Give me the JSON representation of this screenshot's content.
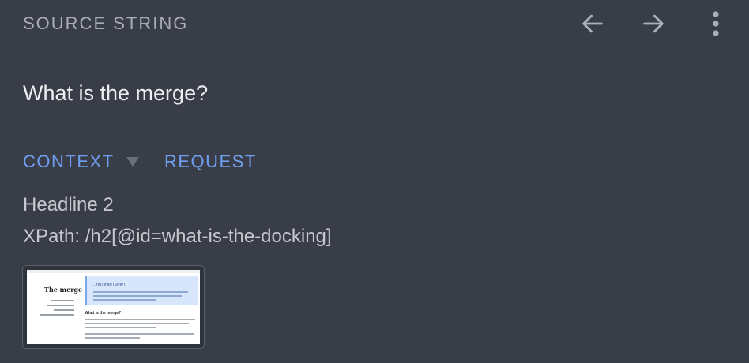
{
  "header": {
    "title": "SOURCE STRING",
    "back_icon": "arrow-left-icon",
    "forward_icon": "arrow-right-icon",
    "more_icon": "more-vertical-icon"
  },
  "source": {
    "text": "What is the merge?"
  },
  "tabs": {
    "context_label": "CONTEXT",
    "request_label": "REQUEST",
    "caret_icon": "caret-down-icon"
  },
  "context": {
    "type": "Headline 2",
    "xpath": "XPath: /h2[@id=what-is-the-docking]"
  },
  "screenshot_thumbnail": {
    "page_heading": "The merge",
    "highlight_heading": "...ng (ship) (SNIP)",
    "section_heading": "What is the merge?"
  },
  "colors": {
    "background": "#393d47",
    "accent": "#6f9ff0",
    "title_text": "#a9adb5",
    "body_text": "#c6c9cf"
  }
}
